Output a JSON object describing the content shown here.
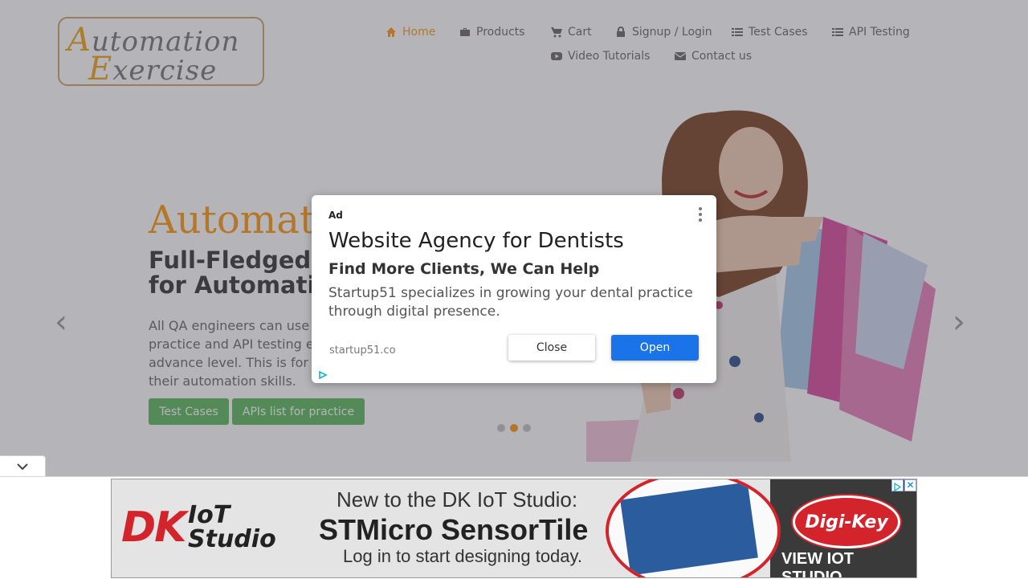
{
  "logo": {
    "line1_cap": "A",
    "line1_rest": "utomation",
    "line2_cap": "E",
    "line2_rest": "xercise"
  },
  "nav": {
    "items": [
      {
        "label": "Home",
        "icon": "home-icon",
        "active": true
      },
      {
        "label": "Products",
        "icon": "briefcase-icon"
      },
      {
        "label": "Cart",
        "icon": "cart-icon"
      },
      {
        "label": "Signup / Login",
        "icon": "lock-icon"
      },
      {
        "label": "Test Cases",
        "icon": "list-icon"
      },
      {
        "label": "API Testing",
        "icon": "list-icon"
      },
      {
        "label": "Video Tutorials",
        "icon": "youtube-icon"
      },
      {
        "label": "Contact us",
        "icon": "envelope-icon"
      }
    ]
  },
  "hero": {
    "title": "Automat",
    "subtitle": "Full-Fledged \nfor Automatio",
    "text": "All QA engineers can use \npractice and API testing e\nadvance level. This is for \ntheir automation skills.",
    "btn_test_cases": "Test Cases",
    "btn_apis": "APIs list for practice",
    "carousel_active_index": 1
  },
  "ad_dialog": {
    "tag": "Ad",
    "headline": "Website Agency for Dentists",
    "subheadline": "Find More Clients, We Can Help",
    "body": "Startup51 specializes in growing your dental practice through digital presence.",
    "domain": "startup51.co",
    "close_label": "Close",
    "open_label": "Open"
  },
  "banner": {
    "brand_left": "DK",
    "brand_left_sub": "IoT\nStudio",
    "line1": "New to the DK IoT Studio:",
    "line2": "STMicro SensorTile",
    "line3": "Log in to start designing today.",
    "brand_right": "Digi-Key",
    "cta": "VIEW IOT STUDIO",
    "close_glyph": "✕"
  },
  "colors": {
    "accent": "#fe980f",
    "green": "#5cb85c",
    "open_button": "#1a73e8"
  }
}
